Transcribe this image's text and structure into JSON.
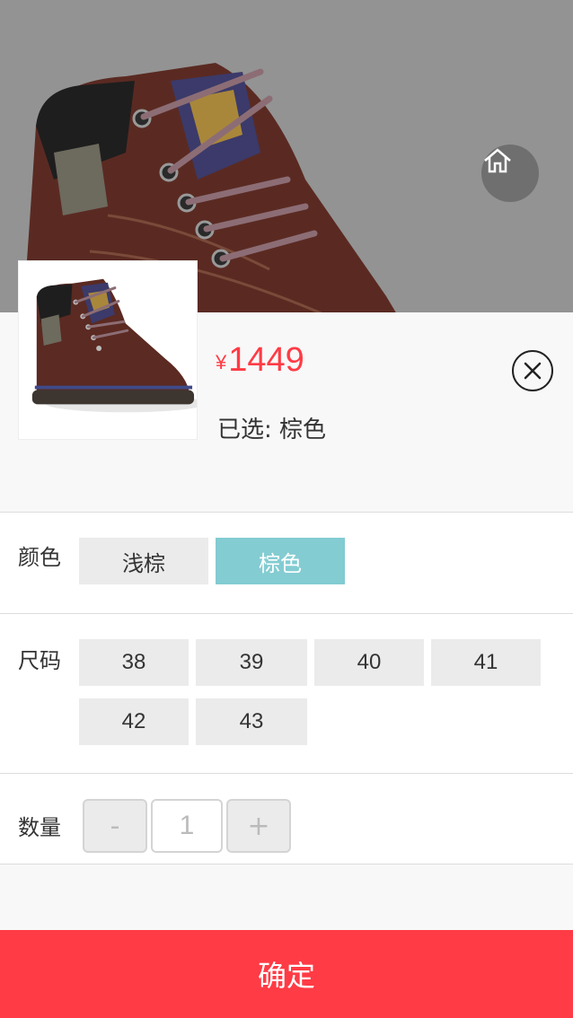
{
  "product": {
    "currency_symbol": "¥",
    "price": "1449",
    "selected_label": "已选: 棕色"
  },
  "icons": {
    "home": "home-icon",
    "close": "close-icon"
  },
  "options": {
    "color": {
      "label": "颜色",
      "items": [
        "浅棕",
        "棕色"
      ],
      "selected": "棕色"
    },
    "size": {
      "label": "尺码",
      "items": [
        "38",
        "39",
        "40",
        "41",
        "42",
        "43"
      ]
    },
    "quantity": {
      "label": "数量",
      "minus": "-",
      "value": "1",
      "plus": "+"
    }
  },
  "confirm_label": "确定",
  "colors": {
    "accent_red": "#ff3b45",
    "selected_chip": "#83ccd2",
    "chip_bg": "#ebebeb"
  }
}
